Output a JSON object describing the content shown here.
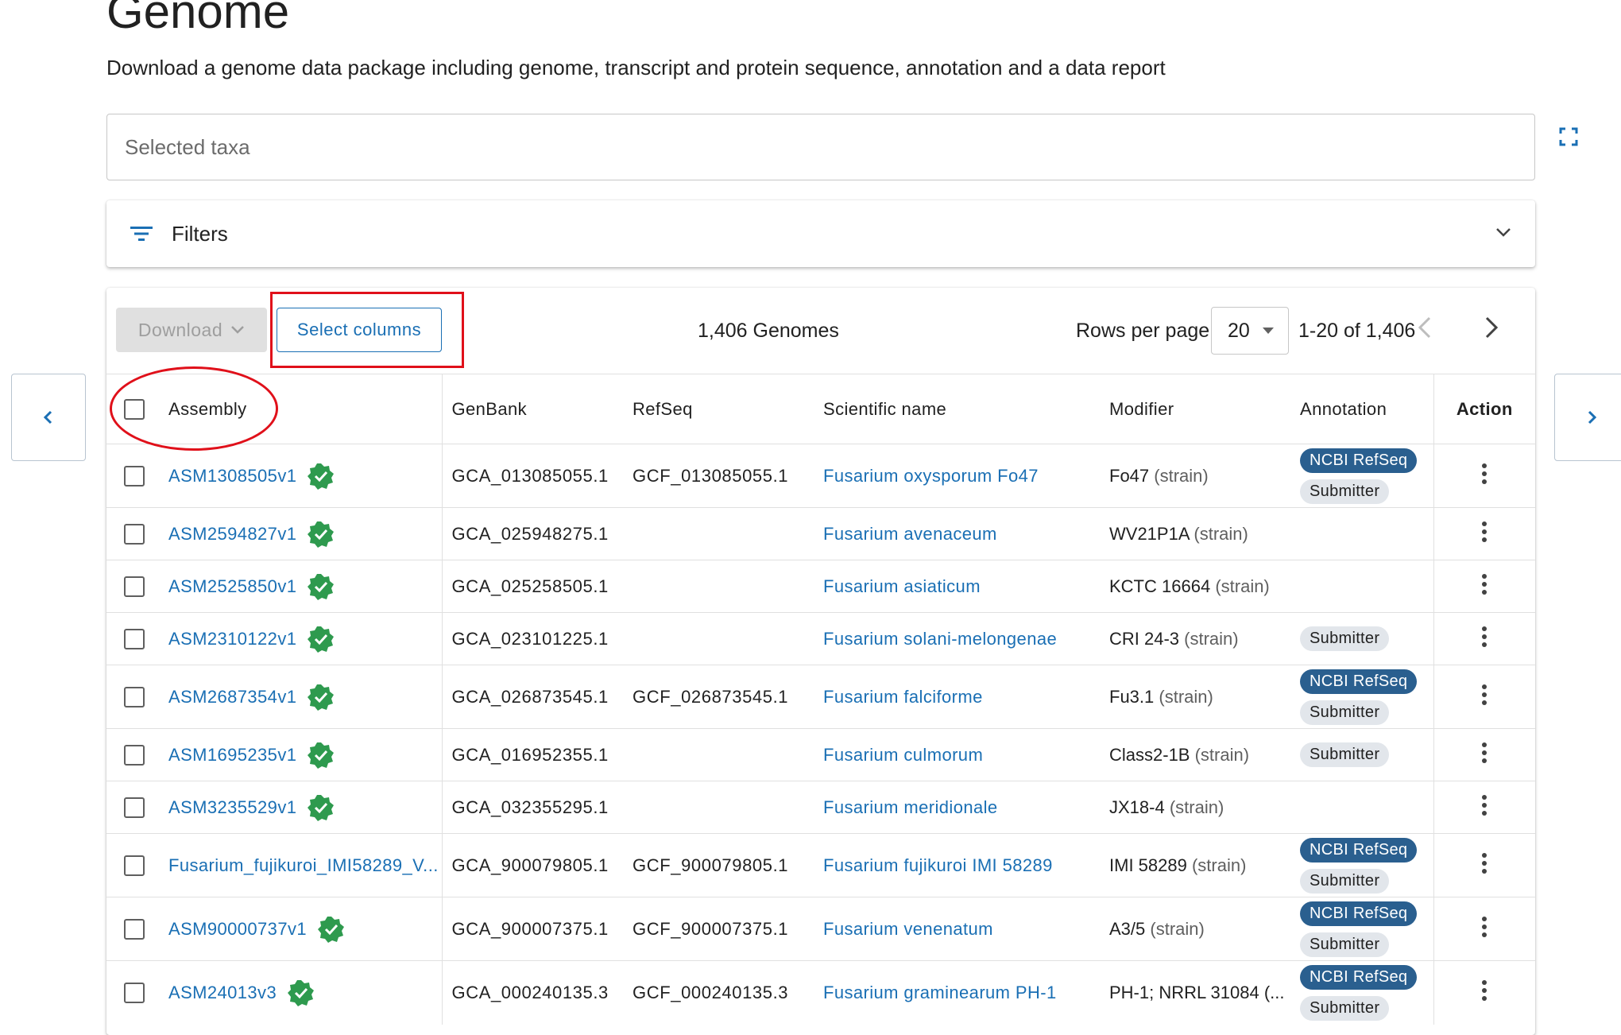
{
  "header": {
    "title": "Genome",
    "subtitle": "Download a genome data package including genome, transcript and protein sequence, annotation and a data report"
  },
  "taxa": {
    "placeholder": "Selected taxa"
  },
  "filters": {
    "label": "Filters"
  },
  "toolbar": {
    "download_label": "Download",
    "select_columns_label": "Select columns",
    "genome_count": "1,406 Genomes",
    "rows_per_page_label": "Rows per page",
    "rows_per_page_value": "20",
    "page_range": "1-20 of 1,406"
  },
  "columns": {
    "assembly": "Assembly",
    "genbank": "GenBank",
    "refseq": "RefSeq",
    "scientific_name": "Scientific name",
    "modifier": "Modifier",
    "annotation": "Annotation",
    "action": "Action"
  },
  "rows": [
    {
      "assembly": "ASM1308505v1",
      "genbank": "GCA_013085055.1",
      "refseq": "GCF_013085055.1",
      "sci": "Fusarium oxysporum Fo47",
      "mod": "Fo47",
      "strain": "(strain)",
      "ncbi": "NCBI RefSeq",
      "sub": "Submitter"
    },
    {
      "assembly": "ASM2594827v1",
      "genbank": "GCA_025948275.1",
      "refseq": "",
      "sci": "Fusarium avenaceum",
      "mod": "WV21P1A",
      "strain": "(strain)",
      "ncbi": "",
      "sub": ""
    },
    {
      "assembly": "ASM2525850v1",
      "genbank": "GCA_025258505.1",
      "refseq": "",
      "sci": "Fusarium asiaticum",
      "mod": "KCTC 16664",
      "strain": "(strain)",
      "ncbi": "",
      "sub": ""
    },
    {
      "assembly": "ASM2310122v1",
      "genbank": "GCA_023101225.1",
      "refseq": "",
      "sci": "Fusarium solani-melongenae",
      "mod": "CRI 24-3",
      "strain": "(strain)",
      "ncbi": "",
      "sub": "Submitter"
    },
    {
      "assembly": "ASM2687354v1",
      "genbank": "GCA_026873545.1",
      "refseq": "GCF_026873545.1",
      "sci": "Fusarium falciforme",
      "mod": "Fu3.1",
      "strain": "(strain)",
      "ncbi": "NCBI RefSeq",
      "sub": "Submitter"
    },
    {
      "assembly": "ASM1695235v1",
      "genbank": "GCA_016952355.1",
      "refseq": "",
      "sci": "Fusarium culmorum",
      "mod": "Class2-1B",
      "strain": "(strain)",
      "ncbi": "",
      "sub": "Submitter"
    },
    {
      "assembly": "ASM3235529v1",
      "genbank": "GCA_032355295.1",
      "refseq": "",
      "sci": "Fusarium meridionale",
      "mod": "JX18-4",
      "strain": "(strain)",
      "ncbi": "",
      "sub": ""
    },
    {
      "assembly": "Fusarium_fujikuroi_IMI58289_V...",
      "genbank": "GCA_900079805.1",
      "refseq": "GCF_900079805.1",
      "sci": "Fusarium fujikuroi IMI 58289",
      "mod": "IMI 58289",
      "strain": "(strain)",
      "ncbi": "NCBI RefSeq",
      "sub": "Submitter"
    },
    {
      "assembly": "ASM90000737v1",
      "genbank": "GCA_900007375.1",
      "refseq": "GCF_900007375.1",
      "sci": "Fusarium venenatum",
      "mod": "A3/5",
      "strain": "(strain)",
      "ncbi": "NCBI RefSeq",
      "sub": "Submitter"
    },
    {
      "assembly": "ASM24013v3",
      "genbank": "GCA_000240135.3",
      "refseq": "GCF_000240135.3",
      "sci": "Fusarium graminearum PH-1",
      "mod": "PH-1; NRRL 31084 (...",
      "strain": "",
      "ncbi": "NCBI RefSeq",
      "sub": "Submitter"
    }
  ],
  "icons": {
    "fullscreen": "fullscreen-icon",
    "filter": "filter-icon",
    "chevron_down": "chevron-down-icon",
    "verified": "verified-check-icon",
    "kebab": "more-vert-icon",
    "prev": "chevron-left-icon",
    "next": "chevron-right-icon"
  },
  "colors": {
    "link": "#1a6fb4",
    "verified": "#2e9a4e",
    "chip_ncbi": "#2a5f8f",
    "chip_submitter": "#e2e6eb",
    "annotation_red": "#e0101a"
  }
}
